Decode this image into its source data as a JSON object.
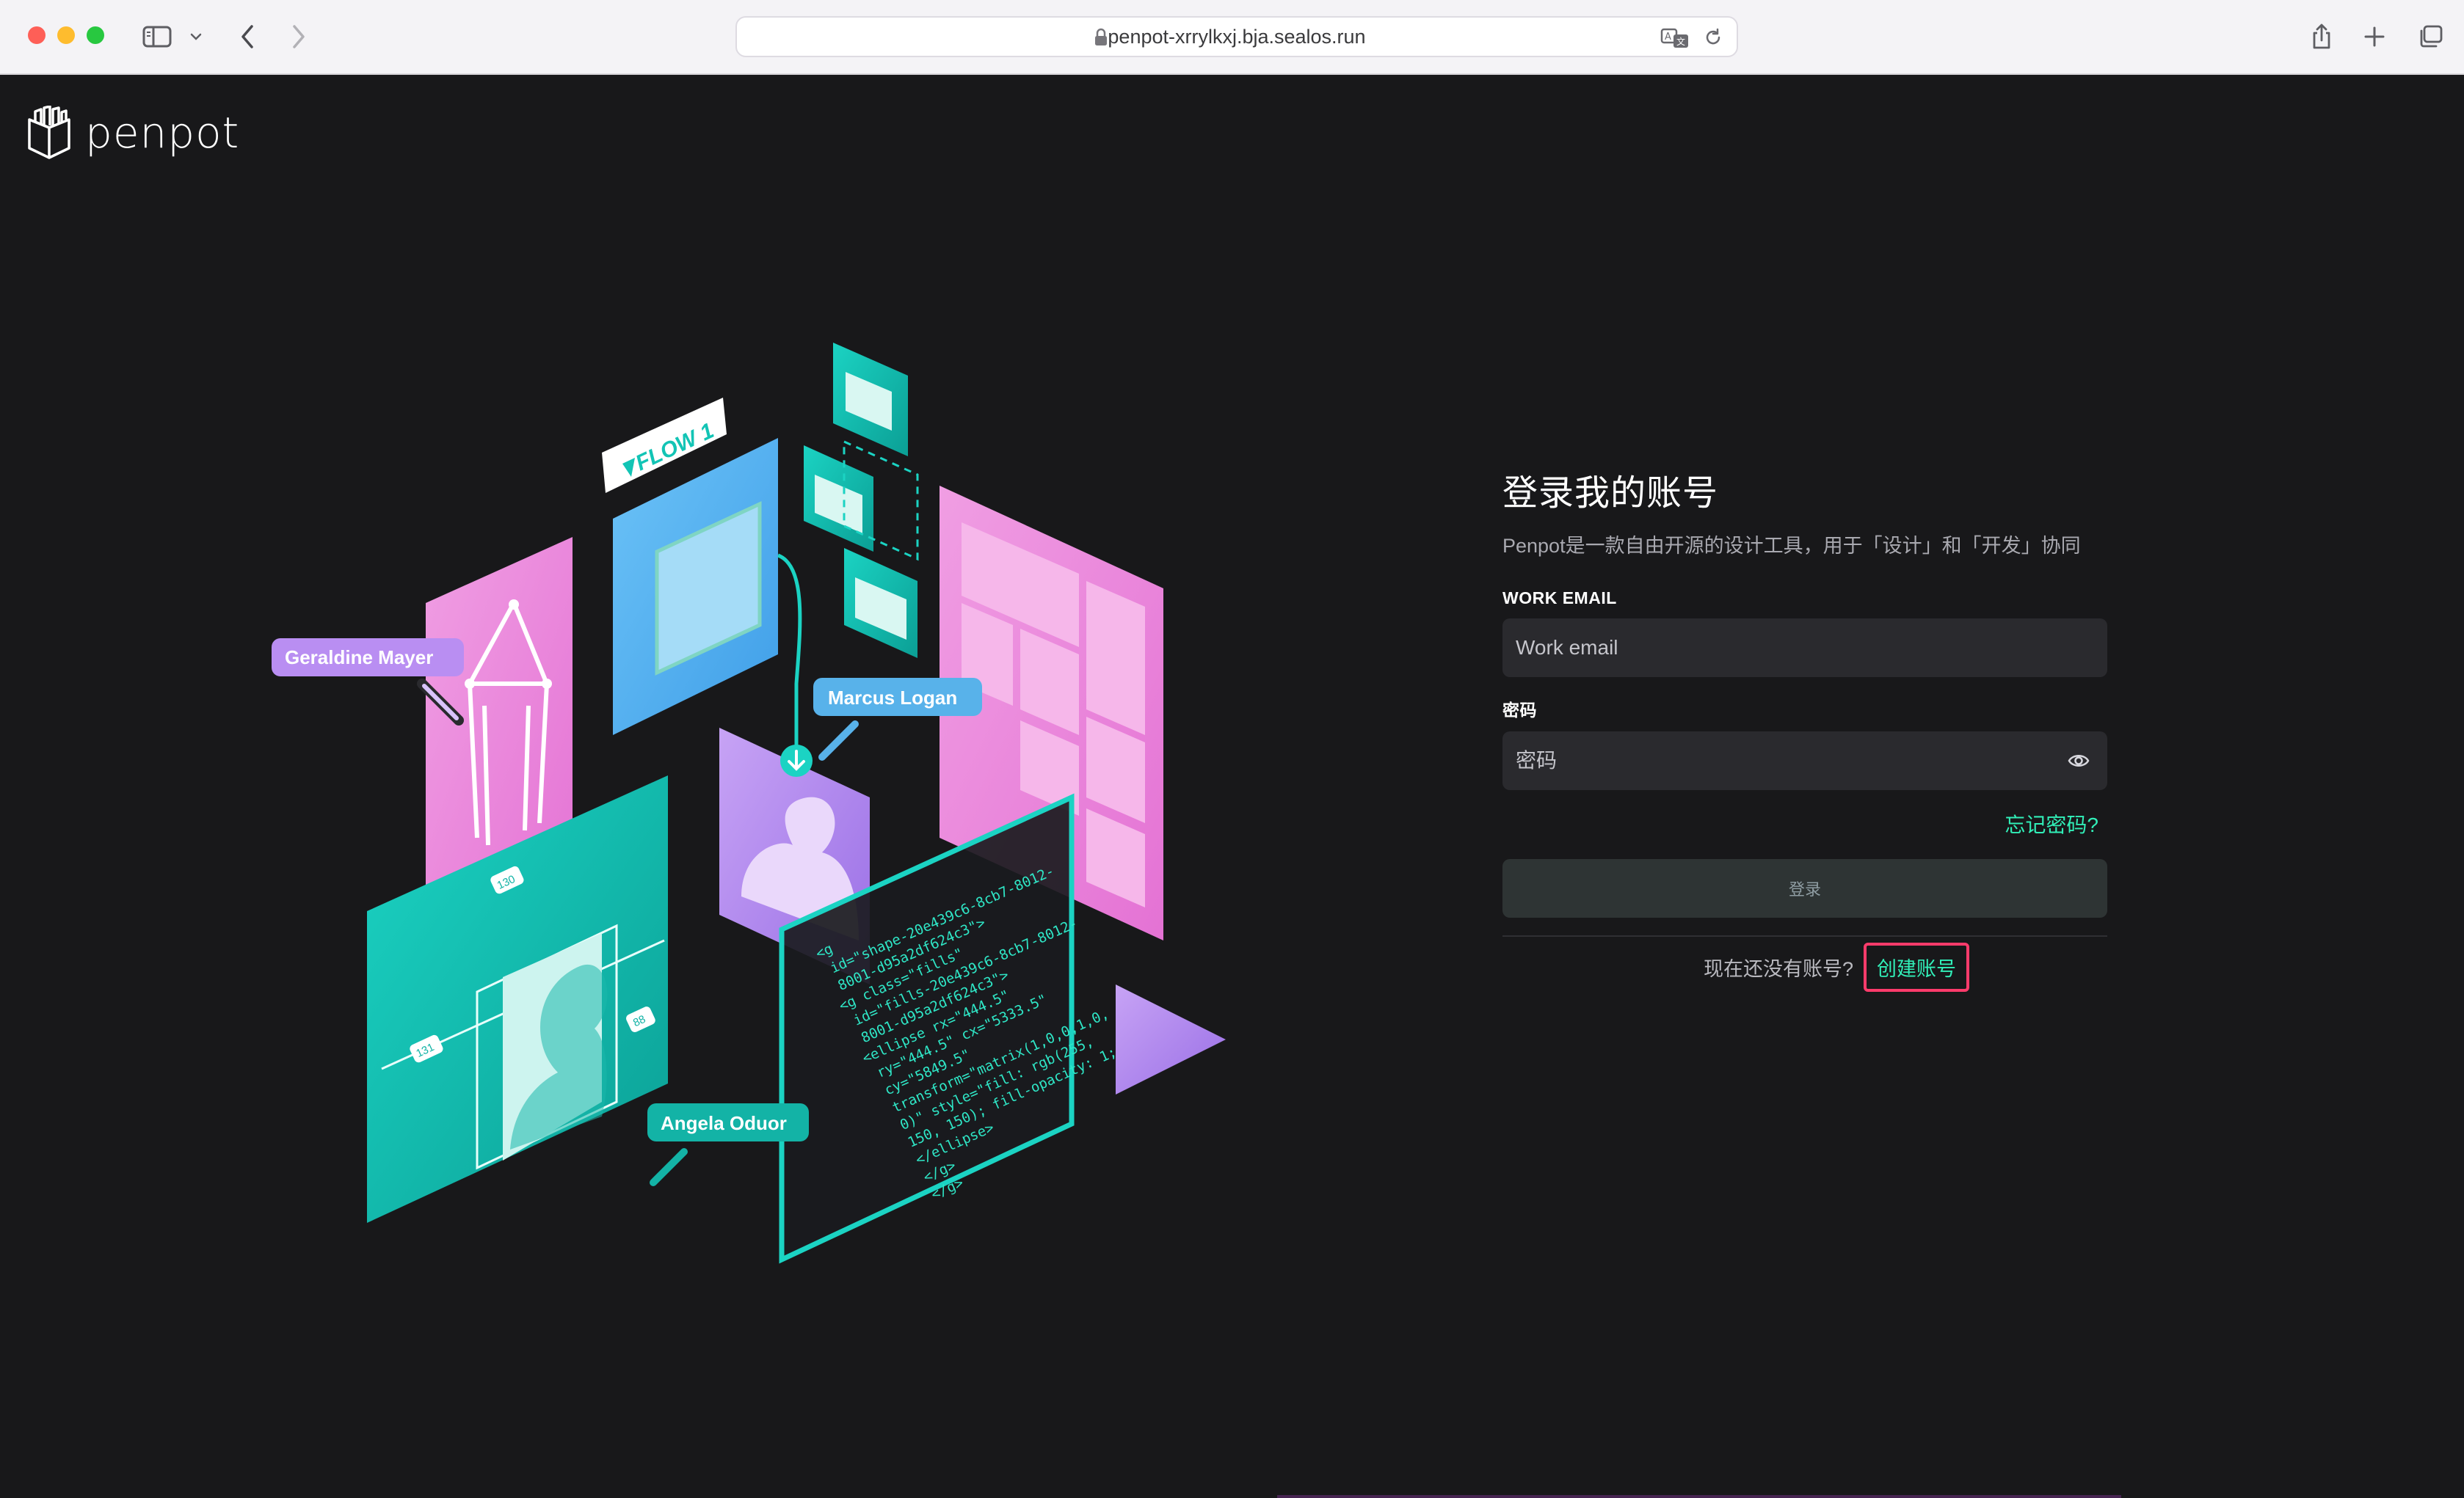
{
  "browser": {
    "url": "penpot-xrrylkxj.bja.sealos.run",
    "icons": [
      "sidebar-icon",
      "chevron-down-icon",
      "back-icon",
      "forward-icon",
      "lock-icon",
      "translate-icon",
      "reload-icon",
      "share-icon",
      "new-tab-icon",
      "tabs-overview-icon"
    ]
  },
  "app": {
    "logo_text": "penpot"
  },
  "illustration": {
    "flow_label": "FLOW 1",
    "cursor_labels": [
      "Geraldine Mayer",
      "Marcus Logan",
      "Angela Oduor"
    ],
    "dimension_tags": [
      "130",
      "131",
      "88"
    ],
    "code_lines": [
      "<g",
      "id=\"shape-20e439c6-8cb7-8012-",
      "8001-d95a2df624c3\">",
      "<g class=\"fills\"",
      "id=\"fills-20e439c6-8cb7-8012-",
      "8001-d95a2df624c3\">",
      "<ellipse rx=\"444.5\"",
      "ry=\"444.5\" cx=\"5333.5\"",
      "cy=\"5849.5\"",
      "transform=\"matrix(1,0,0,1,0,",
      "0)\" style=\"fill: rgb(255,",
      "150, 150); fill-opacity: 1;\">",
      "</ellipse>",
      "</g>",
      "</g>"
    ]
  },
  "login": {
    "title": "登录我的账号",
    "subtitle": "Penpot是一款自由开源的设计工具，用于「设计」和「开发」协同",
    "email_label": "WORK EMAIL",
    "email_placeholder": "Work email",
    "password_label": "密码",
    "password_placeholder": "密码",
    "forgot_label": "忘记密码?",
    "login_button": "登录",
    "no_account_text": "现在还没有账号?",
    "create_account_link": "创建账号"
  },
  "colors": {
    "accent": "#31efb8",
    "background": "#18181a",
    "field": "#2a2a2e",
    "highlight_box": "#ff3b6b"
  }
}
